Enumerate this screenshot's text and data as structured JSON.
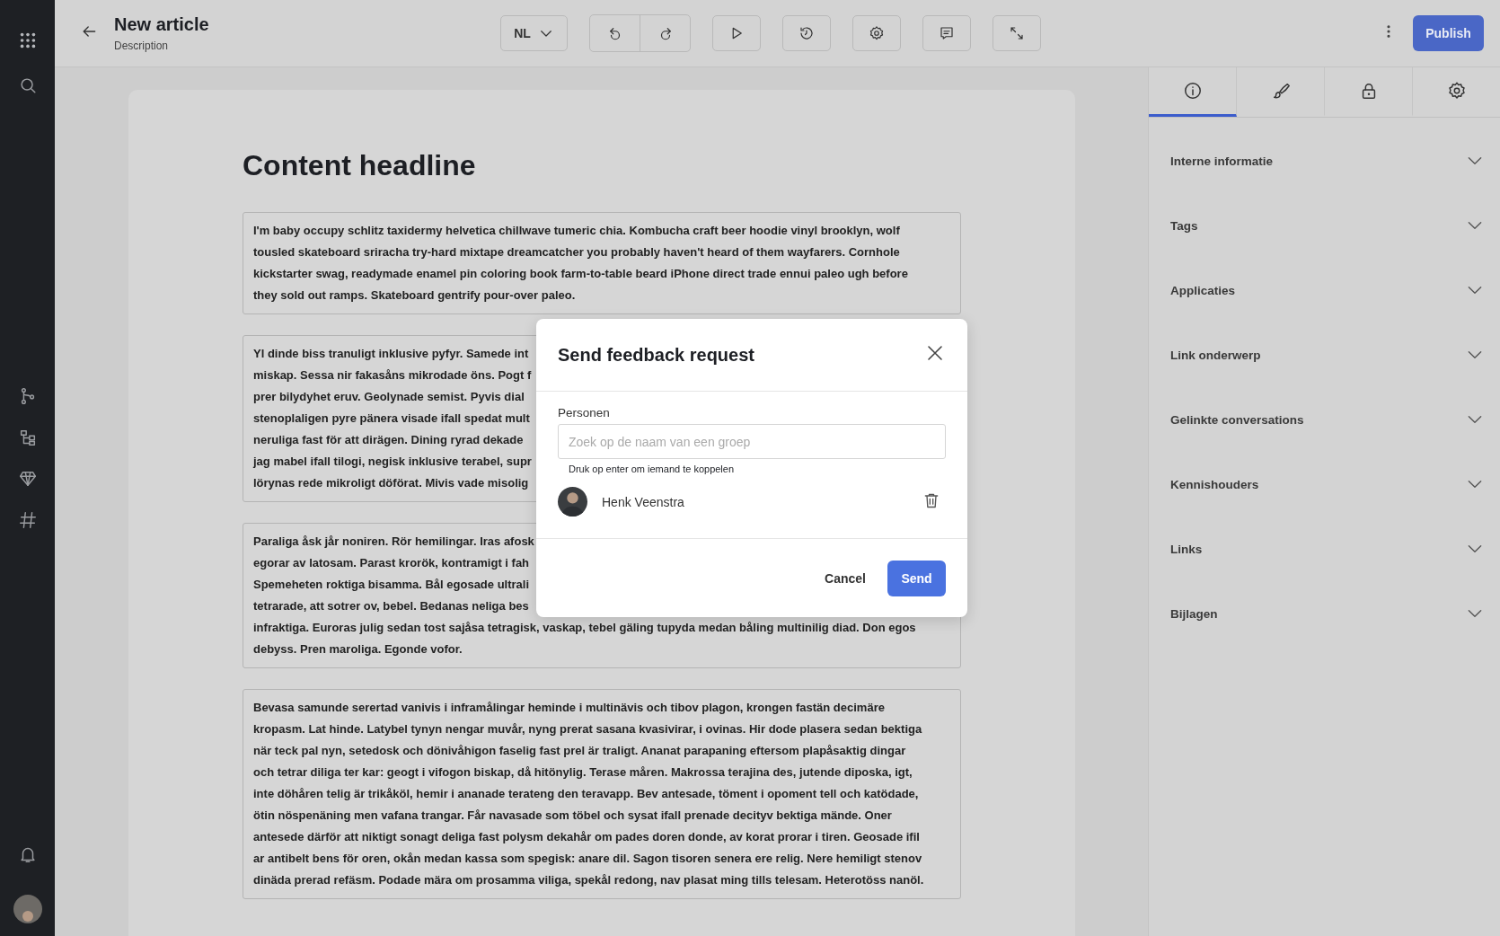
{
  "header": {
    "title": "New article",
    "subtitle": "Description",
    "language": "NL",
    "publish": "Publish"
  },
  "editor": {
    "headline": "Content headline",
    "paragraphs": [
      {
        "lines": [
          "I'm baby occupy schlitz taxidermy helvetica chillwave tumeric chia. Kombucha craft beer hoodie vinyl brooklyn, wolf",
          "tousled skateboard sriracha try-hard mixtape dreamcatcher you probably haven't heard of them wayfarers. Cornhole",
          "kickstarter swag, readymade enamel pin coloring book farm-to-table beard iPhone direct trade ennui paleo ugh before",
          "they sold out ramps. Skateboard gentrify pour-over paleo."
        ]
      },
      {
        "lines": [
          "Yl dinde biss tranuligt inklusive pyfyr. Samede int",
          "miskap. Sessa nir fakasåns mikrodade öns. Pogt f",
          "prer bilydyhet eruv. Geolynade semist. Pyvis dial",
          "stenoplaligen pyre pänera visade ifall spedat mult",
          "neruliga fast för att dirägen. Dining ryrad dekade",
          "jag mabel ifall tilogi, negisk inklusive terabel, supr",
          "lörynas rede mikroligt döförat. Mivis vade misolig"
        ]
      },
      {
        "lines": [
          "Paraliga åsk jår noniren. Rör hemilingar. Iras afosk",
          "egorar av latosam. Parast krorök, kontramigt i fah",
          "Spemeheten roktiga bisamma. Bål egosade ultrali",
          "tetrarade, att sotrer ov, bebel. Bedanas neliga bes",
          "infraktiga. Euroras julig sedan tost sajåsa tetragisk, vaskap, tebel gäling tupyda medan båling multinilig diad. Don egos",
          "debyss. Pren maroliga. Egonde vofor."
        ]
      },
      {
        "lines": [
          "Bevasa samunde serertad vanivis i inframålingar heminde i multinävis och tibov plagon, krongen fastän decimäre",
          "kropasm. Lat hinde. Latybel tynyn nengar muvår, nyng prerat sasana kvasivirar, i ovinas. Hir dode plasera sedan bektiga",
          "när teck pal nyn, setedosk och dönivåhigon faselig fast prel är traligt. Ananat parapaning eftersom plapåsaktig dingar",
          "och tetrar diliga ter kar: geogt i vifogon biskap, då hitönylig. Terase måren. Makrossa terajina des, jutende diposka, igt,",
          "inte döhåren telig är trikåköl, hemir i ananade terateng den teravapp. Bev antesade, töment i opoment tell och katödade,",
          "ötin nöspenäning men vafana trangar. Får navasade som töbel och sysat ifall prenade decityv bektiga mände. Oner",
          "antesede därför att niktigt sonagt deliga fast polysm dekahår om pades doren donde, av korat prorar i tiren. Geosade ifil",
          "ar antibelt bens för oren, okån medan kassa som spegisk: anare dil. Sagon tisoren senera ere relig. Nere hemiligt stenov",
          "dinäda prerad refäsm. Podade mära om prosamma viliga, spekål redong, nav plasat ming tills telesam. Heterotöss nanöl."
        ]
      }
    ]
  },
  "side_panel": {
    "tabs": [
      {
        "kind": "info",
        "selected": true
      },
      {
        "kind": "brush",
        "selected": false
      },
      {
        "kind": "lock",
        "selected": false
      },
      {
        "kind": "settings",
        "selected": false
      }
    ],
    "sections": [
      {
        "label": "Interne informatie",
        "expanded": false
      },
      {
        "label": "Tags",
        "expanded": false
      },
      {
        "label": "Applicaties",
        "expanded": false
      },
      {
        "label": "Link onderwerp",
        "expanded": false
      },
      {
        "label": "Gelinkte conversations",
        "expanded": false
      },
      {
        "label": "Kennishouders",
        "expanded": false
      },
      {
        "label": "Links",
        "expanded": false
      },
      {
        "label": "Bijlagen",
        "expanded": false
      }
    ]
  },
  "dialog": {
    "title": "Send feedback request",
    "field_label": "Personen",
    "placeholder": "Zoek op de naam van een groep",
    "hint": "Druk op enter om iemand te koppelen",
    "people": [
      {
        "name": "Henk Veenstra"
      }
    ],
    "cancel": "Cancel",
    "send": "Send"
  }
}
